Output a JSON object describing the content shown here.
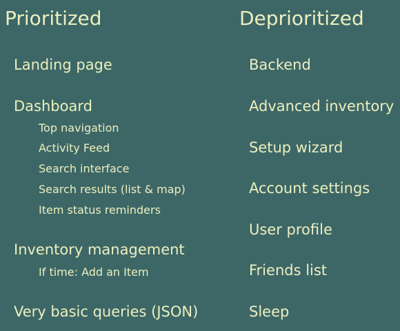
{
  "columns": {
    "prioritized": {
      "title": "Prioritized",
      "items": [
        {
          "label": "Landing page"
        },
        {
          "label": "Dashboard",
          "subitems": [
            "Top navigation",
            "Activity Feed",
            "Search interface",
            "Search results (list & map)",
            "Item status reminders"
          ]
        },
        {
          "label": "Inventory management",
          "subitems": [
            "If time: Add an Item"
          ]
        },
        {
          "label": "Very basic queries (JSON)"
        }
      ]
    },
    "deprioritized": {
      "title": "Deprioritized",
      "items": [
        "Backend",
        "Advanced inventory",
        "Setup wizard",
        "Account settings",
        "User profile",
        "Friends list",
        "Sleep"
      ]
    }
  }
}
